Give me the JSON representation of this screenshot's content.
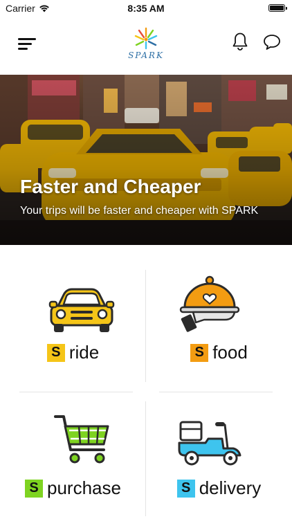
{
  "status_bar": {
    "carrier": "Carrier",
    "time": "8:35 AM",
    "wifi_icon": "wifi-icon",
    "battery_icon": "battery-icon"
  },
  "nav": {
    "menu_icon": "hamburger-menu-icon",
    "logo_text": "SPARK",
    "bell_icon": "bell-icon",
    "chat_icon": "chat-bubble-icon"
  },
  "hero": {
    "title": "Faster and Cheaper",
    "subtitle": "Your trips will be faster and cheaper with SPARK"
  },
  "badge_letter": "S",
  "services": [
    {
      "label": "ride",
      "icon": "car-icon",
      "badge_color": "#f5c518"
    },
    {
      "label": "food",
      "icon": "food-cloche-icon",
      "badge_color": "#f39c12"
    },
    {
      "label": "purchase",
      "icon": "shopping-cart-icon",
      "badge_color": "#7ed321"
    },
    {
      "label": "delivery",
      "icon": "delivery-scooter-icon",
      "badge_color": "#3ec4ee"
    }
  ]
}
